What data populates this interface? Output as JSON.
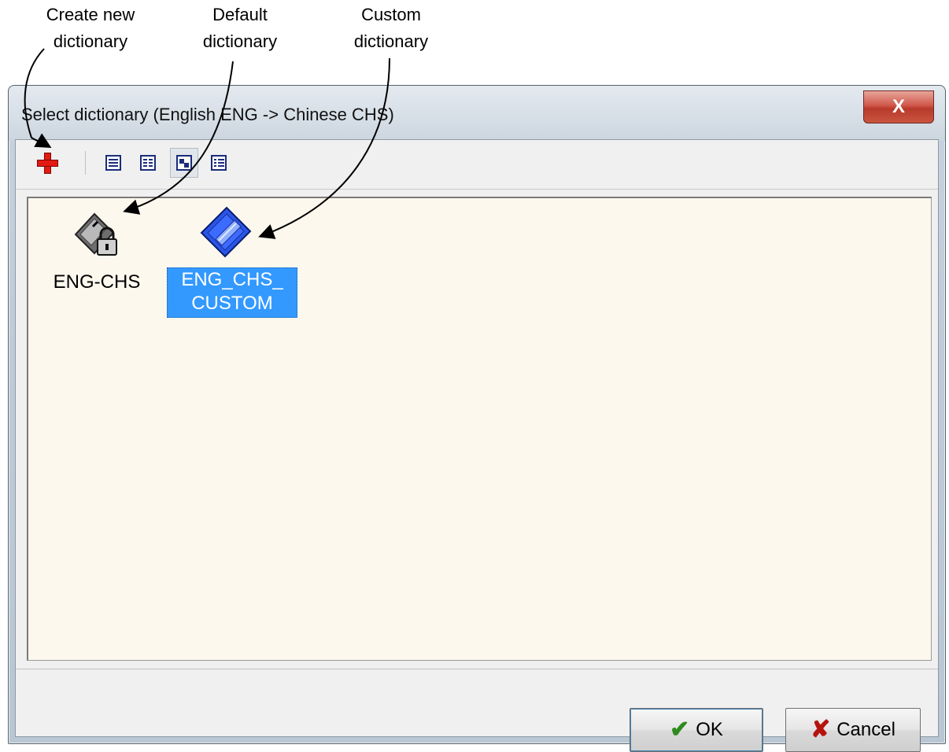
{
  "annotations": {
    "create_new": [
      "Create new",
      "dictionary"
    ],
    "default": [
      "Default",
      "dictionary"
    ],
    "custom": [
      "Custom",
      "dictionary"
    ]
  },
  "window": {
    "title": "Select dictionary (English ENG -> Chinese CHS)",
    "close_glyph": "X"
  },
  "toolbar": {
    "buttons": [
      {
        "name": "new-dictionary-button",
        "icon": "plus-icon"
      },
      {
        "name": "view-list-button",
        "icon": "list-view-icon"
      },
      {
        "name": "view-details-button",
        "icon": "details-view-icon"
      },
      {
        "name": "view-large-icons-button",
        "icon": "large-icons-view-icon",
        "active": true
      },
      {
        "name": "view-small-icons-button",
        "icon": "small-icons-view-icon"
      }
    ]
  },
  "dictionaries": [
    {
      "label": "ENG-CHS",
      "icon": "locked-dictionary-icon",
      "selected": false
    },
    {
      "label_line1": "ENG_CHS_",
      "label_line2": "CUSTOM",
      "icon": "custom-dictionary-icon",
      "selected": true
    }
  ],
  "buttons": {
    "ok": "OK",
    "cancel": "Cancel"
  },
  "colors": {
    "selection": "#3399ff",
    "listview_bg": "#fdf8ee",
    "close_red": "#c9553f",
    "custom_dict_blue": "#2a55e8"
  }
}
